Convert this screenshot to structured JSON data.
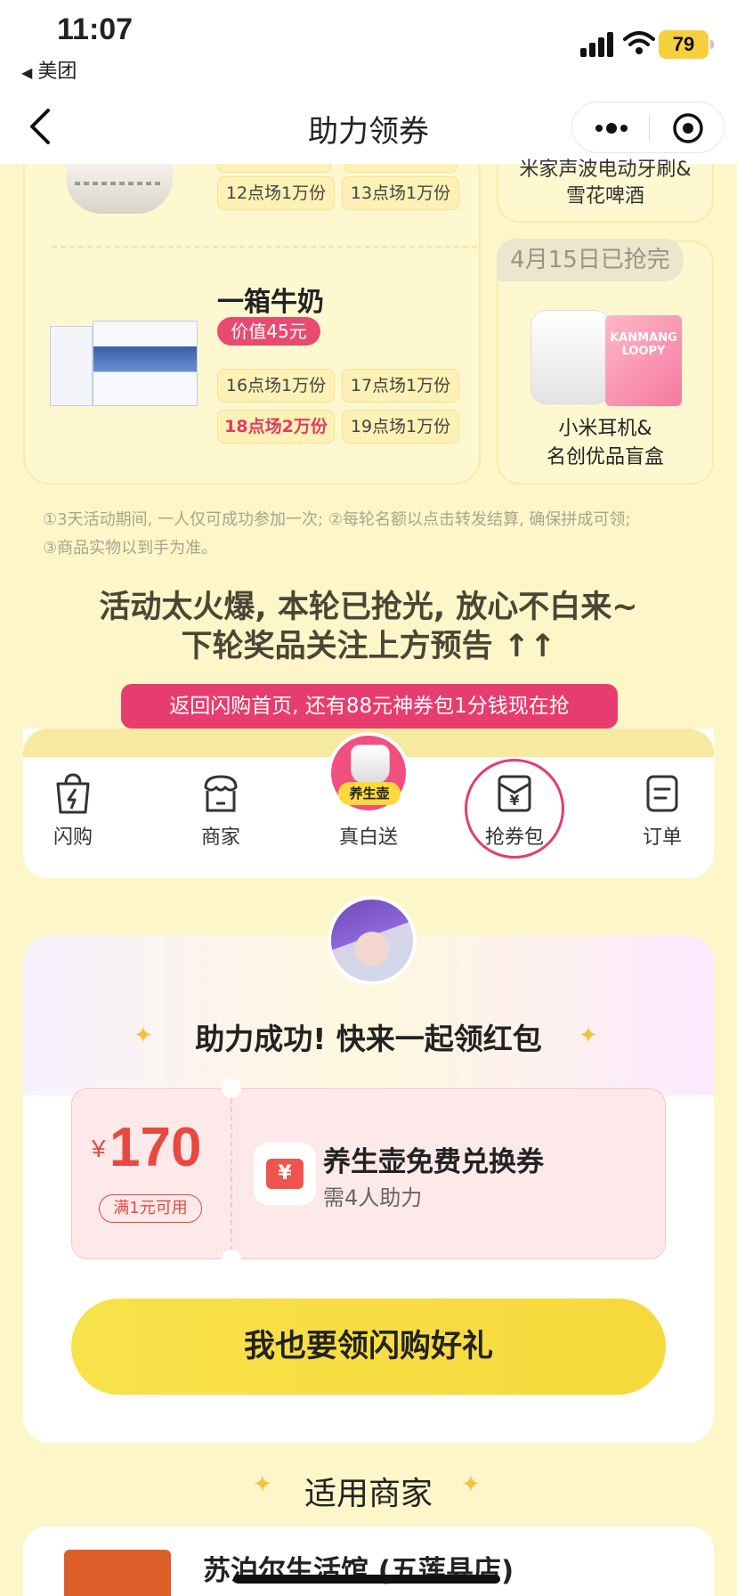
{
  "status_bar": {
    "time": "11:07",
    "back_app": "美团",
    "battery": "79"
  },
  "nav": {
    "title": "助力领券"
  },
  "prizes": {
    "kettle_sessions": [
      "12点场1万份",
      "13点场1万份"
    ],
    "milk": {
      "name": "一箱牛奶",
      "price": "价值45元",
      "sessions": [
        "16点场1万份",
        "17点场1万份",
        "18点场2万份",
        "19点场1万份"
      ]
    },
    "right_top_name": "米家声波电动牙刷&\n雪花啤酒",
    "right_bottom": {
      "tag": "4月15日已抢完",
      "name": "小米耳机&\n名创优品盲盒",
      "box_text": "KANMANG LOOPY"
    }
  },
  "rules": {
    "line1": "①3天活动期间, 一人仅可成功参加一次;  ②每轮名额以点击转发结算, 确保拼成可领;",
    "line2": "③商品实物以到手为准。"
  },
  "headline": {
    "line1": "活动太火爆, 本轮已抢光, 放心不白来~",
    "line2": "下轮奖品关注上方预告 ↑↑"
  },
  "banner": "返回闪购首页, 还有88元神券包1分钱现在抢",
  "tabs": [
    {
      "label": "闪购",
      "icon": "lightning-bag-icon"
    },
    {
      "label": "商家",
      "icon": "store-icon"
    },
    {
      "label": "真白送",
      "icon": "kettle-icon",
      "badge": "养生壶"
    },
    {
      "label": "抢券包",
      "icon": "coupon-bag-icon"
    },
    {
      "label": "订单",
      "icon": "order-icon"
    }
  ],
  "help": {
    "title": "助力成功! 快来一起领红包",
    "coupon": {
      "currency": "¥",
      "amount": "170",
      "condition": "满1元可用",
      "icon_text": "¥",
      "title": "养生壶免费兑换券",
      "subtitle": "需4人助力"
    },
    "cta": "我也要领闪购好礼"
  },
  "merchants": {
    "title": "适用商家",
    "first_store": "苏泊尔生活馆 (五莲县店)"
  },
  "colors": {
    "accent_pink": "#e63c70",
    "accent_yellow": "#f8e24a",
    "page_bg": "#fdf6c8",
    "coupon_red": "#e8483e"
  }
}
